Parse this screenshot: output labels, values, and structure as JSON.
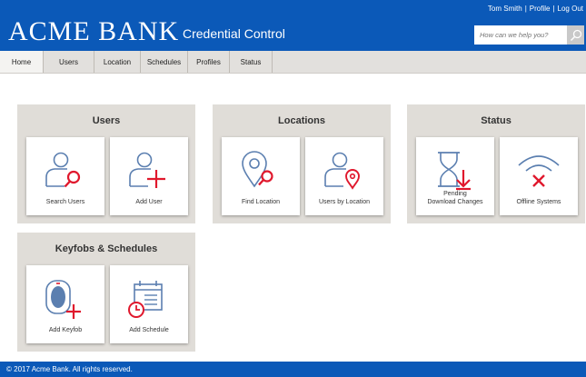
{
  "header": {
    "logo": "ACME BANK",
    "subtitle": "Credential Control",
    "user_name": "Tom Smith",
    "profile_link": "Profile",
    "logout_link": "Log Out",
    "separator": "|",
    "search_placeholder": "How can we help you?"
  },
  "nav": {
    "tabs": [
      {
        "label": "Home"
      },
      {
        "label": "Users"
      },
      {
        "label": "Location"
      },
      {
        "label": "Schedules"
      },
      {
        "label": "Profiles"
      },
      {
        "label": "Status"
      }
    ],
    "active_tab": "Home"
  },
  "panels": {
    "users": {
      "title": "Users",
      "cards": [
        {
          "label": "Search Users",
          "icon": "search-user-icon"
        },
        {
          "label": "Add User",
          "icon": "add-user-icon"
        }
      ]
    },
    "locations": {
      "title": "Locations",
      "cards": [
        {
          "label": "Find Location",
          "icon": "find-location-icon"
        },
        {
          "label": "Users by Location",
          "icon": "users-by-location-icon"
        }
      ]
    },
    "status": {
      "title": "Status",
      "cards": [
        {
          "label": "Pending\nDownload Changes",
          "icon": "hourglass-download-icon"
        },
        {
          "label": "Offline Systems",
          "icon": "wifi-offline-icon"
        }
      ]
    },
    "keyfobs": {
      "title": "Keyfobs & Schedules",
      "cards": [
        {
          "label": "Add Keyfob",
          "icon": "add-keyfob-icon"
        },
        {
          "label": "Add Schedule",
          "icon": "add-schedule-icon"
        }
      ]
    }
  },
  "footer": {
    "copyright": "© 2017 Acme Bank. All rights reserved."
  },
  "colors": {
    "brand_blue": "#0b59b8",
    "icon_blue": "#5b7fb0",
    "icon_red": "#e0182d",
    "panel_bg": "#e0ddd8",
    "nav_bg": "#e2e0dd"
  }
}
